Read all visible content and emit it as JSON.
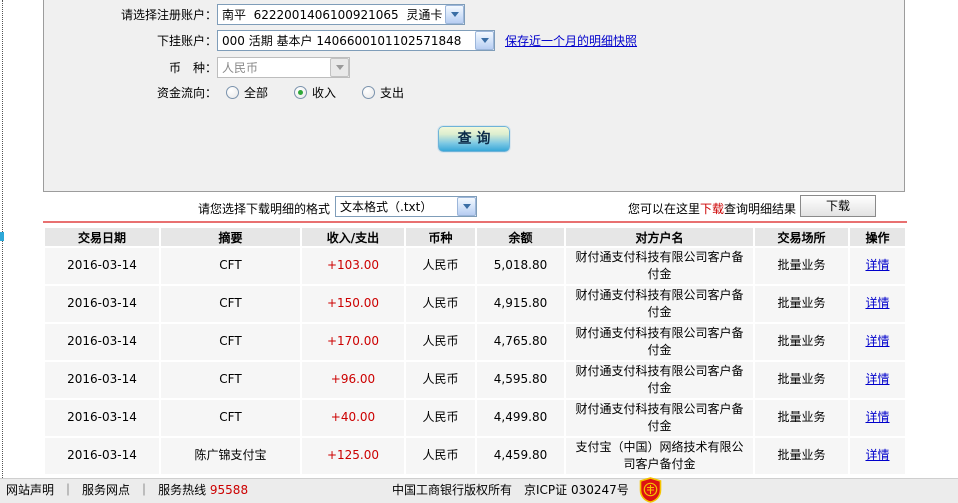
{
  "colors": {
    "amount_positive": "#cc0000",
    "link_blue": "#0000cc",
    "hotline_red": "#cc0000",
    "divider_red": "#e87070"
  },
  "form": {
    "register_account_label": "请选择注册账户：",
    "register_account_value": "南平  6222001406100921065  灵通卡",
    "sub_account_label": "下挂账户：",
    "sub_account_value": "000 活期 基本户 1406600101102571848",
    "snapshot_link": "保存近一个月的明细快照",
    "currency_label": "币　种：",
    "currency_value": "人民币",
    "fund_flow_label": "资金流向：",
    "fund_flow_options": [
      {
        "label": "全部",
        "selected": false
      },
      {
        "label": "收入",
        "selected": true
      },
      {
        "label": "支出",
        "selected": false
      }
    ],
    "query_button": "查 询"
  },
  "download": {
    "format_label": "请您选择下载明细的格式",
    "format_value": "文本格式（.txt）",
    "hint_prefix": "您可以在这里",
    "hint_link": "下载",
    "hint_suffix": "查询明细结果",
    "button": "下载"
  },
  "table": {
    "headers": [
      "交易日期",
      "摘要",
      "收入/支出",
      "币种",
      "余额",
      "对方户名",
      "交易场所",
      "操作"
    ],
    "rows": [
      {
        "date": "2016-03-14",
        "summary": "CFT",
        "amount": "+103.00",
        "currency": "人民币",
        "balance": "5,018.80",
        "counterparty": "财付通支付科技有限公司客户备付金",
        "venue": "批量业务",
        "action": "详情"
      },
      {
        "date": "2016-03-14",
        "summary": "CFT",
        "amount": "+150.00",
        "currency": "人民币",
        "balance": "4,915.80",
        "counterparty": "财付通支付科技有限公司客户备付金",
        "venue": "批量业务",
        "action": "详情"
      },
      {
        "date": "2016-03-14",
        "summary": "CFT",
        "amount": "+170.00",
        "currency": "人民币",
        "balance": "4,765.80",
        "counterparty": "财付通支付科技有限公司客户备付金",
        "venue": "批量业务",
        "action": "详情"
      },
      {
        "date": "2016-03-14",
        "summary": "CFT",
        "amount": "+96.00",
        "currency": "人民币",
        "balance": "4,595.80",
        "counterparty": "财付通支付科技有限公司客户备付金",
        "venue": "批量业务",
        "action": "详情"
      },
      {
        "date": "2016-03-14",
        "summary": "CFT",
        "amount": "+40.00",
        "currency": "人民币",
        "balance": "4,499.80",
        "counterparty": "财付通支付科技有限公司客户备付金",
        "venue": "批量业务",
        "action": "详情"
      },
      {
        "date": "2016-03-14",
        "summary": "陈广锦支付宝",
        "amount": "+125.00",
        "currency": "人民币",
        "balance": "4,459.80",
        "counterparty": "支付宝（中国）网络技术有限公司客户备付金",
        "venue": "批量业务",
        "action": "详情"
      }
    ]
  },
  "footer": {
    "link_statement": "网站声明",
    "link_branches": "服务网点",
    "separator": "｜",
    "hotline_label": "服务热线",
    "hotline_number": "95588",
    "copyright": "中国工商银行版权所有　京ICP证 030247号",
    "seal_icon": "icbc-security-seal"
  }
}
